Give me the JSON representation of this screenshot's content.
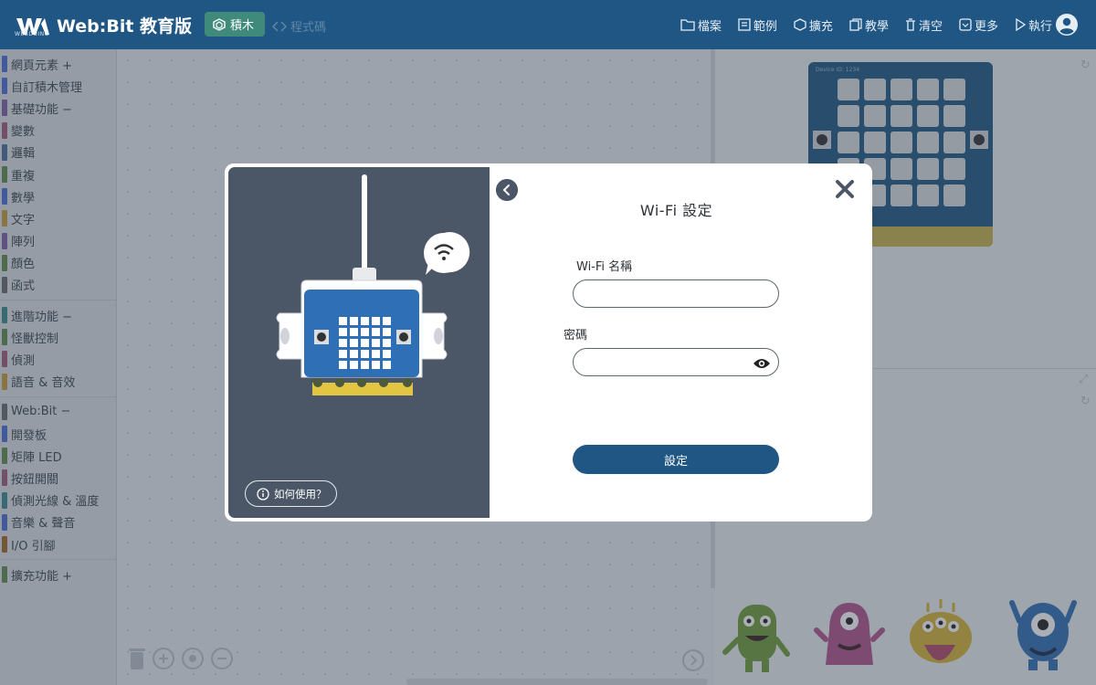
{
  "app": {
    "title": "Web:Bit 教育版",
    "logo_sub": "WEBDUINO"
  },
  "header": {
    "tabs": [
      {
        "label": "積木",
        "active": true
      },
      {
        "label": "程式碼",
        "active": false
      }
    ],
    "menu": [
      "檔案",
      "範例",
      "擴充",
      "教學",
      "清空",
      "更多",
      "執行"
    ]
  },
  "toolbox": {
    "groups": [
      [
        {
          "label": "網頁元素 +",
          "color": "#4a6cd4"
        },
        {
          "label": "自訂積木管理",
          "color": "#4a6cd4"
        },
        {
          "label": "基礎功能 −",
          "color": "#7b5fa8"
        },
        {
          "label": "變數",
          "color": "#a05a7a"
        },
        {
          "label": "邏輯",
          "color": "#4f6a9a"
        },
        {
          "label": "重複",
          "color": "#5f8a4f"
        },
        {
          "label": "數學",
          "color": "#4a6cd4"
        },
        {
          "label": "文字",
          "color": "#c79a3a"
        },
        {
          "label": "陣列",
          "color": "#7b5fa8"
        },
        {
          "label": "顏色",
          "color": "#5f8a4f"
        },
        {
          "label": "函式",
          "color": "#6a6a6a"
        }
      ],
      [
        {
          "label": "進階功能 −",
          "color": "#3a8a8a"
        },
        {
          "label": "怪獸控制",
          "color": "#5f8a4f"
        },
        {
          "label": "偵測",
          "color": "#a05a7a"
        },
        {
          "label": "語音 & 音效",
          "color": "#c79a3a"
        }
      ],
      [
        {
          "label": "Web:Bit −",
          "color": "#6a6a6a"
        },
        {
          "label": "開發板",
          "color": "#4a6cd4"
        },
        {
          "label": "矩陣 LED",
          "color": "#5f8a4f"
        },
        {
          "label": "按鈕開關",
          "color": "#a05a7a"
        },
        {
          "label": "偵測光線 & 溫度",
          "color": "#3a8a8a"
        },
        {
          "label": "音樂 & 聲音",
          "color": "#4a6cd4"
        },
        {
          "label": "I/O 引腳",
          "color": "#a0662a"
        }
      ],
      [
        {
          "label": "擴充功能 +",
          "color": "#5f8a4f"
        }
      ]
    ]
  },
  "preview": {
    "device_id": "Device ID: 1234"
  },
  "dialog": {
    "title": "Wi-Fi 設定",
    "ssid_label": "Wi-Fi 名稱",
    "ssid_value": "",
    "password_label": "密碼",
    "password_value": "",
    "submit_label": "設定",
    "help_label": "如何使用？"
  },
  "colors": {
    "header": "#1f5684",
    "accent_tab": "#3f8a7a",
    "modal_left": "#4b5767",
    "board": "#1f5684"
  }
}
